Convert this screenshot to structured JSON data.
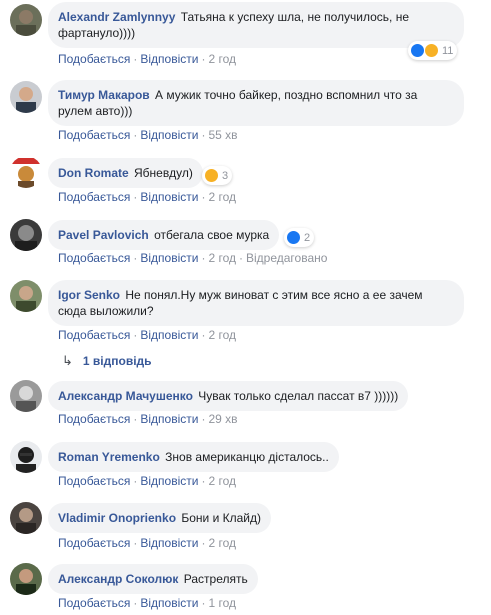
{
  "actions": {
    "like": "Подобається",
    "reply": "Відповісти",
    "edited": "Відредаговано"
  },
  "comments": [
    {
      "author": "Alexandr Zamlynnyy",
      "text": "Татьяна к успеху шла, не получилось, не фартануло))))",
      "time": "2 год",
      "reactions": {
        "count": "11",
        "icons": [
          "like-icon",
          "haha-icon"
        ]
      }
    },
    {
      "author": "Тимур Макаров",
      "text": "А мужик точно байкер, поздно вспомнил что за рулем авто)))",
      "time": "55 хв"
    },
    {
      "author": "Don Romate",
      "text": "Ябневдул)",
      "time": "2 год",
      "reactions": {
        "count": "3",
        "icons": [
          "haha-icon"
        ]
      }
    },
    {
      "author": "Pavel Pavlovich",
      "text": "отбегала свое мурка",
      "time": "2 год",
      "edited": true,
      "reactions": {
        "count": "2",
        "icons": [
          "like-icon"
        ]
      }
    },
    {
      "author": "Igor Senko",
      "text": "Не понял.Ну муж виноват с этим все ясно а ее зачем сюда выложили?",
      "time": "2 год"
    },
    {
      "author": "Александр Мачушенко",
      "text": "Чувак только сделал пассат в7 ))))))",
      "time": "29 хв"
    },
    {
      "author": "Roman Yremenko",
      "text": "Знов американцю дісталось..",
      "time": "2 год"
    },
    {
      "author": "Vladimir Onoprienko",
      "text": "Бони и Клайд)",
      "time": "2 год"
    },
    {
      "author": "Александр Соколюк",
      "text": "Растрелять",
      "time": "1 год"
    }
  ],
  "replies_link": "1 відповідь",
  "colors": {
    "link": "#385898",
    "bubble": "#f2f3f5",
    "meta": "#90949c",
    "like": "#1877f2",
    "haha": "#f7b125"
  }
}
